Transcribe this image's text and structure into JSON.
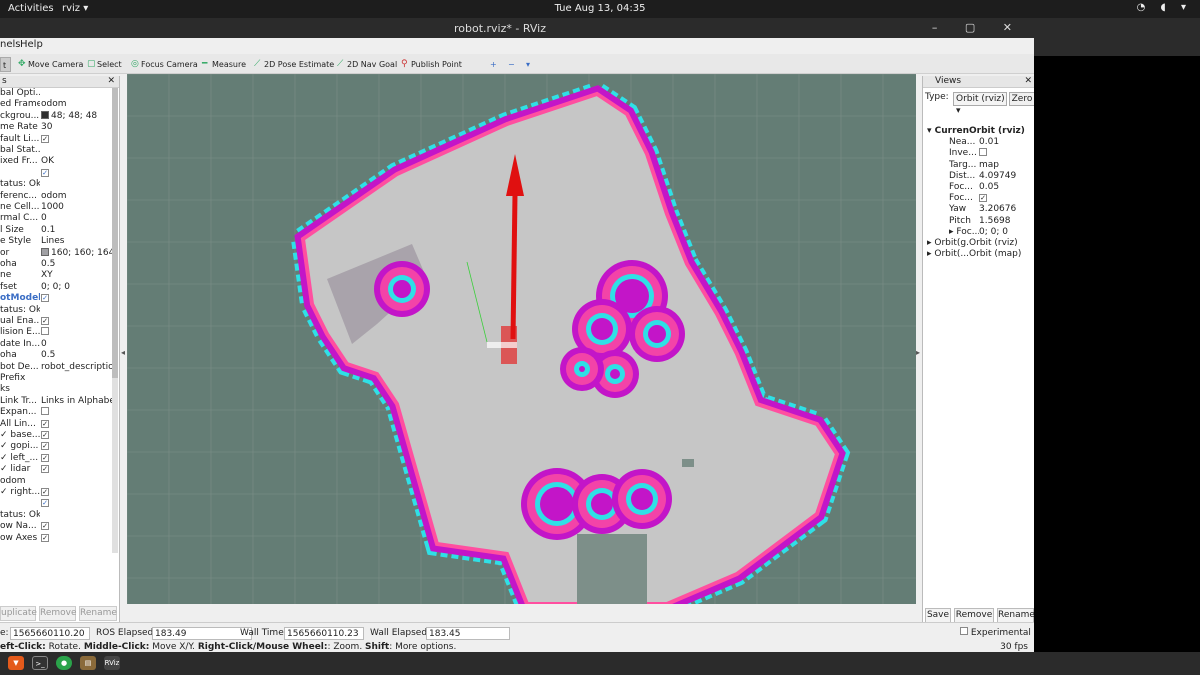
{
  "system": {
    "activities": "Activities",
    "app_name": "rviz ▾",
    "clock": "Tue Aug 13, 04:35"
  },
  "window": {
    "title": "robot.rviz* - RViz"
  },
  "menu": {
    "items": [
      "nels",
      "Help"
    ]
  },
  "toolbar": {
    "interact": "t",
    "move_camera": "Move Camera",
    "select": "Select",
    "focus_camera": "Focus Camera",
    "measure": "Measure",
    "pose_estimate": "2D Pose Estimate",
    "nav_goal": "2D Nav Goal",
    "publish_point": "Publish Point"
  },
  "displays": {
    "header": "s",
    "rows": [
      {
        "k": "bal Opti...",
        "v": ""
      },
      {
        "k": "ed Frame",
        "v": "odom"
      },
      {
        "k": "ckgrou...",
        "v": "48; 48; 48",
        "swatch": "#303030"
      },
      {
        "k": "me Rate",
        "v": "30"
      },
      {
        "k": "fault Li...",
        "v": "✓",
        "check": true
      },
      {
        "k": "bal Stat...",
        "v": ""
      },
      {
        "k": "ixed Fr...",
        "v": "OK"
      },
      {
        "k": "",
        "v": "✓",
        "check": true,
        "blue": true
      },
      {
        "k": "tatus: Ok",
        "v": ""
      },
      {
        "k": "ferenc...",
        "v": "odom"
      },
      {
        "k": "ne Cell...",
        "v": "1000"
      },
      {
        "k": "rmal C...",
        "v": "0"
      },
      {
        "k": "l Size",
        "v": "0.1"
      },
      {
        "k": "e Style",
        "v": "Lines"
      },
      {
        "k": "or",
        "v": "160; 160; 164",
        "swatch": "#a0a0a4"
      },
      {
        "k": "oha",
        "v": "0.5"
      },
      {
        "k": "ne",
        "v": "XY"
      },
      {
        "k": "fset",
        "v": "0; 0; 0"
      },
      {
        "k": "otModel",
        "v": "✓",
        "check": true,
        "blue": true,
        "hl": true
      },
      {
        "k": "tatus: Ok",
        "v": ""
      },
      {
        "k": "ual Ena...",
        "v": "✓",
        "check": true
      },
      {
        "k": "lision E...",
        "v": "",
        "check": true
      },
      {
        "k": "date In...",
        "v": "0"
      },
      {
        "k": "oha",
        "v": "0.5"
      },
      {
        "k": "bot De...",
        "v": "robot_descriptio"
      },
      {
        "k": " Prefix",
        "v": ""
      },
      {
        "k": "ks",
        "v": ""
      },
      {
        "k": "Link Tr...",
        "v": "Links in Alphabe..."
      },
      {
        "k": " Expan...",
        "v": "",
        "check": true
      },
      {
        "k": " All Lin...",
        "v": "✓",
        "check": true
      },
      {
        "k": "✓ base...",
        "v": "✓",
        "check": true
      },
      {
        "k": "✓ gopi...",
        "v": "✓",
        "check": true
      },
      {
        "k": "✓ left_...",
        "v": "✓",
        "check": true
      },
      {
        "k": "✓ lidar",
        "v": "✓",
        "check": true
      },
      {
        "k": "  odom",
        "v": ""
      },
      {
        "k": "✓ right...",
        "v": "✓",
        "check": true
      },
      {
        "k": "",
        "v": "✓",
        "check": true,
        "blue": true
      },
      {
        "k": "tatus: Ok",
        "v": ""
      },
      {
        "k": "ow Na...",
        "v": "✓",
        "check": true
      },
      {
        "k": "ow Axes",
        "v": "✓",
        "check": true
      }
    ],
    "buttons": {
      "duplicate": "uplicate",
      "remove": "Remove",
      "rename": "Rename"
    }
  },
  "views": {
    "header": "Views",
    "type_label": "Type:",
    "type_value": "Orbit (rviz) ▾",
    "zero": "Zero",
    "rows": [
      {
        "k": "▾ Curren...",
        "v": "Orbit (rviz)",
        "bold": true
      },
      {
        "k": "Nea...",
        "v": "0.01"
      },
      {
        "k": "Inve...",
        "v": "",
        "check": true
      },
      {
        "k": "Targ...",
        "v": "map"
      },
      {
        "k": "Dist...",
        "v": "4.09749"
      },
      {
        "k": "Foc...",
        "v": "0.05"
      },
      {
        "k": "Foc...",
        "v": "✓",
        "check": true
      },
      {
        "k": "Yaw",
        "v": "3.20676"
      },
      {
        "k": "Pitch",
        "v": "1.5698"
      },
      {
        "k": "▸ Foc...",
        "v": "0; 0; 0"
      },
      {
        "k": "▸ Orbit(g...",
        "v": "Orbit (rviz)"
      },
      {
        "k": "▸ Orbit(...",
        "v": "Orbit (map)"
      }
    ],
    "buttons": {
      "save": "Save",
      "remove": "Remove",
      "rename": "Rename"
    }
  },
  "status": {
    "ros_time_label": "e:",
    "ros_time": "1565660110.20",
    "ros_elapsed_label": "ROS Elapsed:",
    "ros_elapsed": "183.49",
    "wall_time_label": "Wall Time:",
    "wall_time": "1565660110.23",
    "wall_elapsed_label": "Wall Elapsed:",
    "wall_elapsed": "183.45",
    "experimental": "Experimental",
    "fps": "30 fps",
    "hint_left": "eft-Click:",
    "hint_left_v": " Rotate. ",
    "hint_mid": "Middle-Click:",
    "hint_mid_v": " Move X/Y. ",
    "hint_right": "Right-Click/Mouse Wheel:",
    "hint_right_v": ": Zoom. ",
    "hint_shift": "Shift",
    "hint_shift_v": ": More options."
  },
  "dock": {
    "rviz_label": "RViz"
  },
  "map": {
    "background": "#647d75",
    "free": "#c6c6c6",
    "magenta": "#c315c8",
    "cyan": "#2fe0e6",
    "pink": "#ff4fa0",
    "arrow": "#e01010"
  }
}
